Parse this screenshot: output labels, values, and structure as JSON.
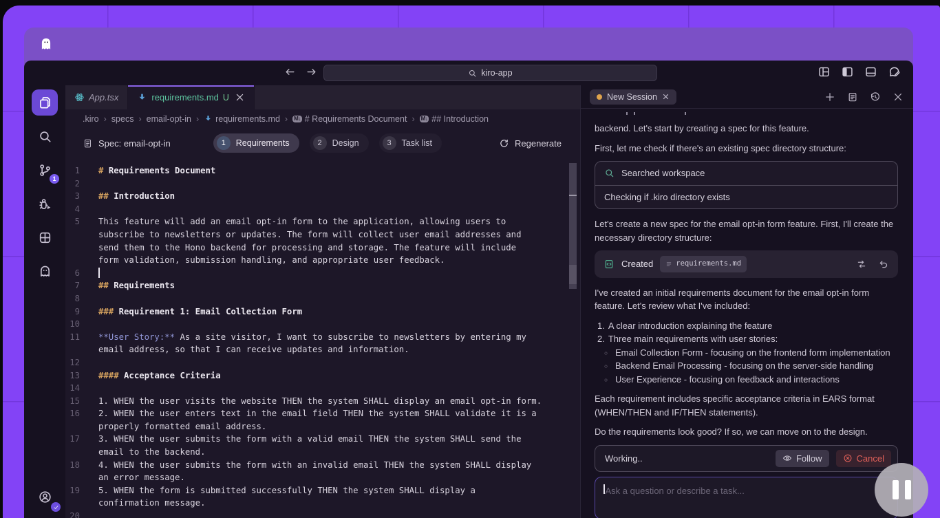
{
  "topbar": {
    "search_value": "kiro-app",
    "icons": [
      "layout-grid",
      "panel-left",
      "panel-bottom",
      "feedback"
    ]
  },
  "activity_bar": {
    "items": [
      {
        "id": "explorer",
        "icon": "files",
        "active": true
      },
      {
        "id": "search",
        "icon": "search",
        "active": false
      },
      {
        "id": "source-control",
        "icon": "git",
        "active": false,
        "badge": "1"
      },
      {
        "id": "run-debug",
        "icon": "debug",
        "active": false
      },
      {
        "id": "extensions",
        "icon": "extensions",
        "active": false
      },
      {
        "id": "kiro-assistant",
        "icon": "ghost",
        "active": false
      }
    ],
    "account": {
      "icon": "account",
      "verified": true
    }
  },
  "tabs": [
    {
      "label": "App.tsx",
      "icon": "react",
      "italic": true,
      "active": false
    },
    {
      "label": "requirements.md",
      "icon": "md-arrow",
      "suffix": "U",
      "active": true,
      "closable": true
    }
  ],
  "breadcrumb": [
    {
      "label": ".kiro"
    },
    {
      "label": "specs"
    },
    {
      "label": "email-opt-in"
    },
    {
      "label": "requirements.md",
      "icon": "md-arrow"
    },
    {
      "label": "# Requirements Document",
      "icon": "md-symbol"
    },
    {
      "label": "## Introduction",
      "icon": "md-symbol"
    }
  ],
  "spec_bar": {
    "label": "Spec: email-opt-in",
    "steps": [
      {
        "num": "1",
        "label": "Requirements",
        "active": true
      },
      {
        "num": "2",
        "label": "Design",
        "active": false
      },
      {
        "num": "3",
        "label": "Task list",
        "active": false
      }
    ],
    "regenerate_label": "Regenerate"
  },
  "editor": {
    "rows": [
      {
        "n": "1",
        "parts": [
          {
            "s": "hash",
            "t": "# "
          },
          {
            "s": "head",
            "t": "Requirements Document"
          }
        ]
      },
      {
        "n": "2",
        "parts": []
      },
      {
        "n": "3",
        "parts": [
          {
            "s": "hash",
            "t": "## "
          },
          {
            "s": "head",
            "t": "Introduction"
          }
        ]
      },
      {
        "n": "4",
        "parts": []
      },
      {
        "n": "5",
        "parts": [
          {
            "s": "",
            "t": "This feature will add an email opt-in form to the application, allowing users to"
          }
        ]
      },
      {
        "n": "",
        "parts": [
          {
            "s": "",
            "t": "subscribe to newsletters or updates. The form will collect user email addresses and"
          }
        ]
      },
      {
        "n": "",
        "parts": [
          {
            "s": "",
            "t": "send them to the Hono backend for processing and storage. The feature will include"
          }
        ]
      },
      {
        "n": "",
        "parts": [
          {
            "s": "",
            "t": "form validation, submission handling, and appropriate user feedback."
          }
        ]
      },
      {
        "n": "6",
        "parts": [
          {
            "s": "caret",
            "t": ""
          }
        ]
      },
      {
        "n": "7",
        "parts": [
          {
            "s": "hash",
            "t": "## "
          },
          {
            "s": "head",
            "t": "Requirements"
          }
        ]
      },
      {
        "n": "8",
        "parts": []
      },
      {
        "n": "9",
        "parts": [
          {
            "s": "hash",
            "t": "### "
          },
          {
            "s": "head",
            "t": "Requirement 1: Email Collection Form"
          }
        ]
      },
      {
        "n": "10",
        "parts": []
      },
      {
        "n": "11",
        "parts": [
          {
            "s": "strong",
            "t": "**User Story:**"
          },
          {
            "s": "",
            "t": " As a site visitor, I want to subscribe to newsletters by entering my"
          }
        ]
      },
      {
        "n": "",
        "parts": [
          {
            "s": "",
            "t": "email address, so that I can receive updates and information."
          }
        ]
      },
      {
        "n": "12",
        "parts": []
      },
      {
        "n": "13",
        "parts": [
          {
            "s": "hash",
            "t": "#### "
          },
          {
            "s": "head",
            "t": "Acceptance Criteria"
          }
        ]
      },
      {
        "n": "14",
        "parts": []
      },
      {
        "n": "15",
        "parts": [
          {
            "s": "",
            "t": "1. WHEN the user visits the website THEN the system SHALL display an email opt-in form."
          }
        ]
      },
      {
        "n": "16",
        "parts": [
          {
            "s": "",
            "t": "2. WHEN the user enters text in the email field THEN the system SHALL validate it is a"
          }
        ]
      },
      {
        "n": "",
        "parts": [
          {
            "s": "",
            "t": "properly formatted email address."
          }
        ]
      },
      {
        "n": "17",
        "parts": [
          {
            "s": "",
            "t": "3. WHEN the user submits the form with a valid email THEN the system SHALL send the"
          }
        ]
      },
      {
        "n": "",
        "parts": [
          {
            "s": "",
            "t": "email to the backend."
          }
        ]
      },
      {
        "n": "18",
        "parts": [
          {
            "s": "",
            "t": "4. WHEN the user submits the form with an invalid email THEN the system SHALL display"
          }
        ]
      },
      {
        "n": "",
        "parts": [
          {
            "s": "",
            "t": "an error message."
          }
        ]
      },
      {
        "n": "19",
        "parts": [
          {
            "s": "",
            "t": "5. WHEN the form is submitted successfully THEN the system SHALL display a"
          }
        ]
      },
      {
        "n": "",
        "parts": [
          {
            "s": "",
            "t": "confirmation message."
          }
        ]
      },
      {
        "n": "20",
        "parts": []
      }
    ]
  },
  "chat": {
    "session_tab": {
      "label": "New Session"
    },
    "header_icons": [
      "plus",
      "tasks",
      "history",
      "close"
    ],
    "blocks": [
      {
        "type": "clipped"
      },
      {
        "type": "p",
        "text": "backend. Let's start by creating a spec for this feature."
      },
      {
        "type": "p",
        "text": "First, let me check if there's an existing spec directory structure:"
      },
      {
        "type": "tool_card",
        "rows": [
          {
            "icon": "search",
            "text": "Searched workspace"
          },
          {
            "text": "Checking if .kiro directory exists"
          }
        ]
      },
      {
        "type": "p",
        "text": "Let's create a new spec for the email opt-in form feature. First, I'll create the necessary directory structure:"
      },
      {
        "type": "file_card",
        "action": "Created",
        "file": "requirements.md"
      },
      {
        "type": "p",
        "text": "I've created an initial requirements document for the email opt-in form feature. Let's review what I've included:"
      },
      {
        "type": "ol",
        "items": [
          "A clear introduction explaining the feature",
          "Three main requirements with user stories:"
        ]
      },
      {
        "type": "ul",
        "items": [
          "Email Collection Form - focusing on the frontend form implementation",
          "Backend Email Processing - focusing on the server-side handling",
          "User Experience - focusing on feedback and interactions"
        ]
      },
      {
        "type": "p",
        "text": "Each requirement includes specific acceptance criteria in EARS format (WHEN/THEN and IF/THEN statements)."
      },
      {
        "type": "p",
        "text": "Do the requirements look good? If so, we can move on to the design."
      }
    ],
    "status": {
      "text": "Working..",
      "follow_label": "Follow",
      "cancel_label": "Cancel"
    },
    "input": {
      "placeholder": "Ask a question or describe a task..."
    }
  },
  "colors": {
    "desktop_purple": "#8343f6",
    "titlebar_purple": "#7b50c6",
    "tab_accent": "#8a63e8",
    "markdown_green": "#5dc49e",
    "heading_hash": "#d3a05e",
    "user_story_purple": "#9297d8",
    "success_green": "#4fae8d",
    "cancel_red": "#e06059",
    "session_dot": "#dfa44c"
  }
}
